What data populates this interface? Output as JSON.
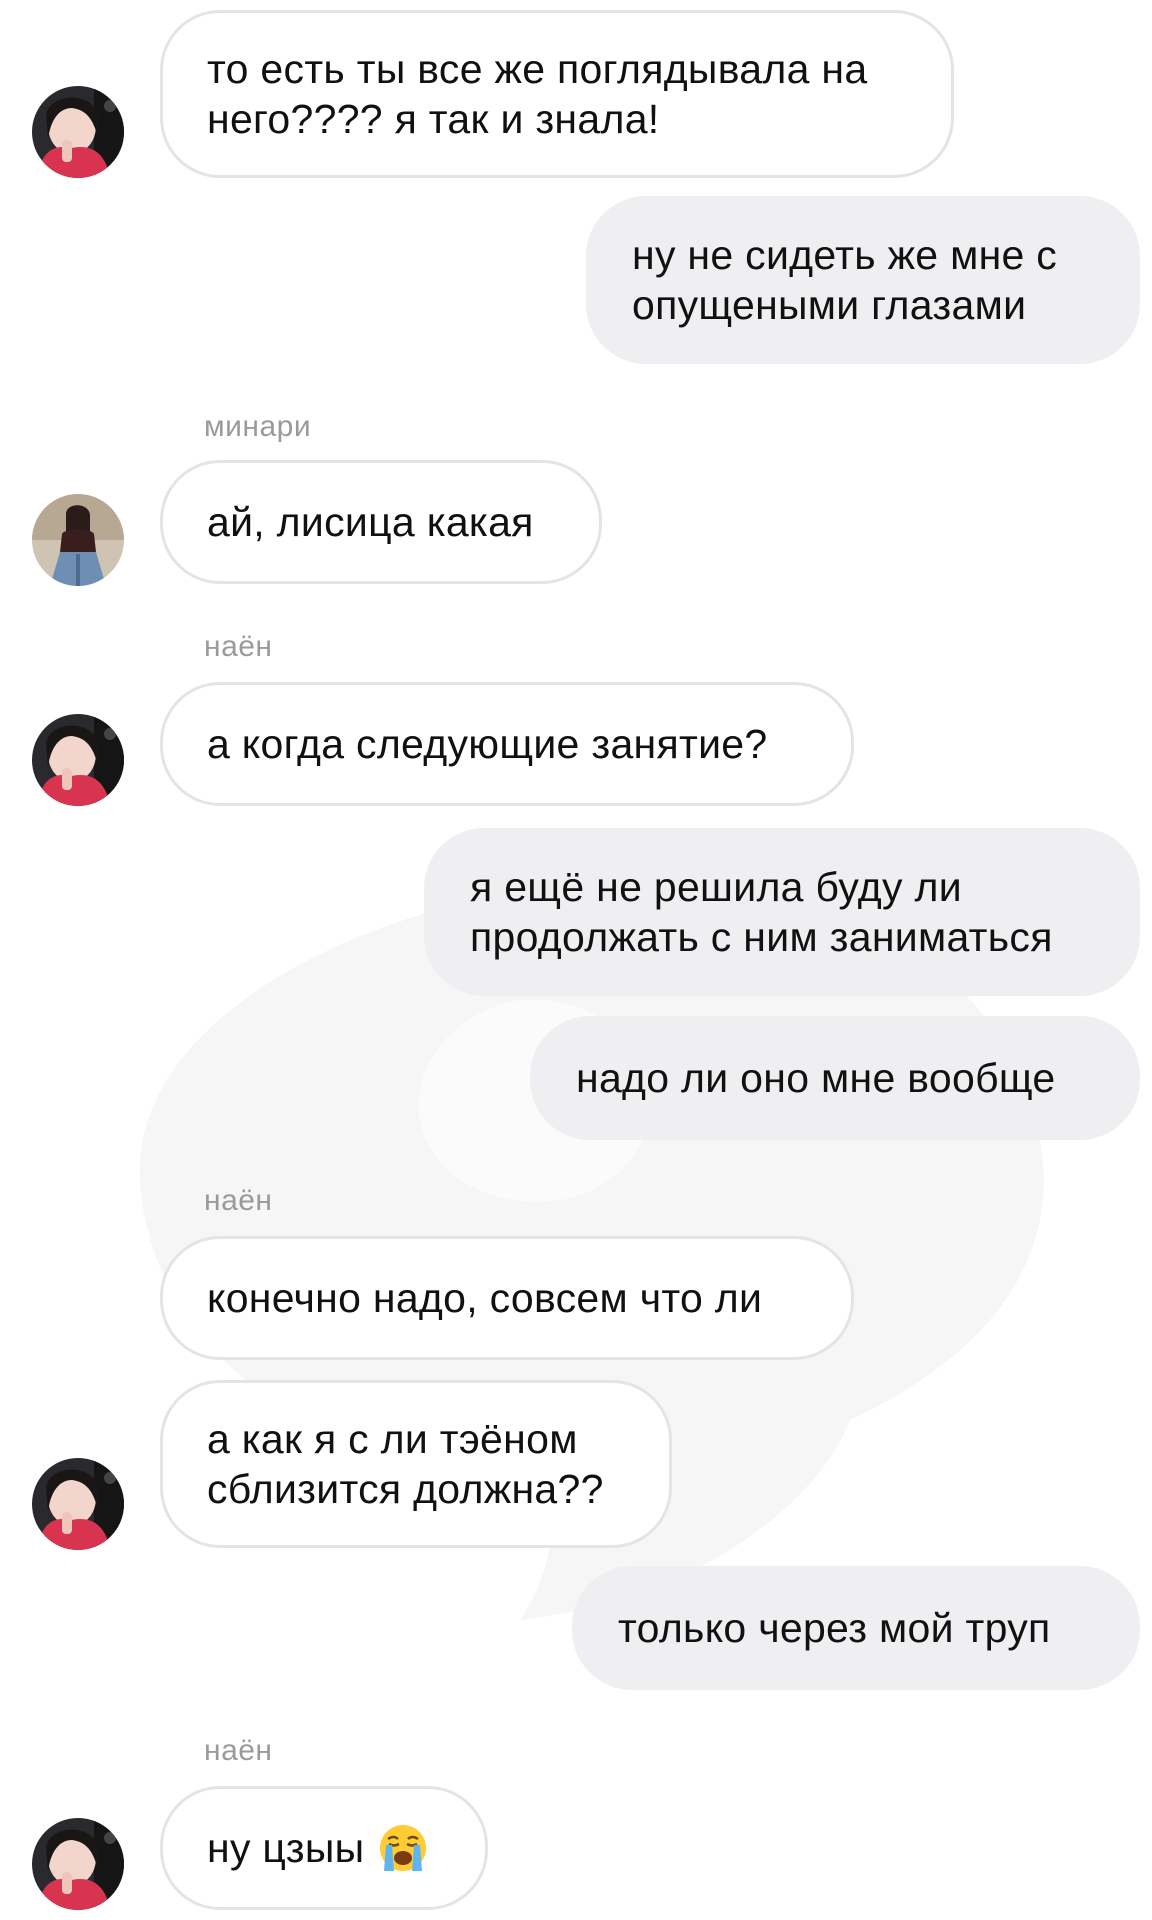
{
  "messages": [
    {
      "text": "то есть ты все же поглядывала на\nнего???? я так и знала!"
    },
    {
      "text": "ну не сидеть же мне с\nопущеными глазами"
    },
    {
      "sender": "минари",
      "text": "ай, лисица какая"
    },
    {
      "sender": "наён",
      "text": "а когда следующие занятие?"
    },
    {
      "text": "я ещё не решила буду ли\nпродолжать с ним заниматься"
    },
    {
      "text": "надо ли оно мне вообще"
    },
    {
      "sender": "наён",
      "text": "конечно надо, совсем что ли"
    },
    {
      "text": "а как я с ли тэёном\nсблизится должна??"
    },
    {
      "text": "только через мой труп"
    },
    {
      "sender": "наён",
      "text": "ну цзыы",
      "emoji": "crying-face-icon"
    }
  ],
  "colors": {
    "incoming_bubble": "#ffffff",
    "incoming_border": "#e4e4e4",
    "outgoing_bubble": "#efeff1",
    "sender_name": "#9a9a9a",
    "watermark": "#f4f4f4"
  }
}
